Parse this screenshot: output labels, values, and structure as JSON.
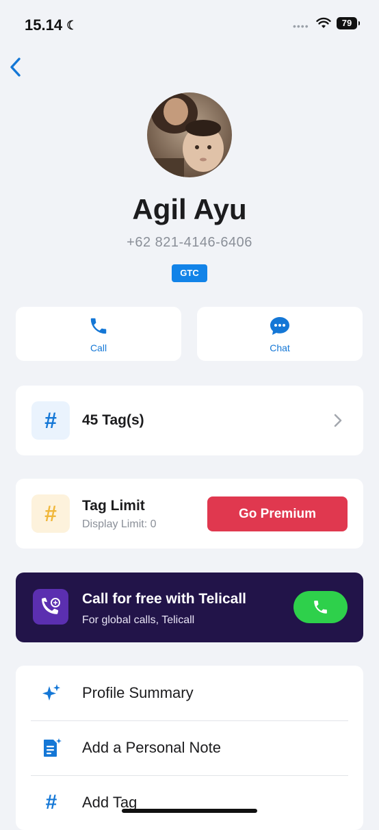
{
  "status_bar": {
    "time": "15.14",
    "moon_icon": "moon-icon",
    "battery": "79"
  },
  "contact": {
    "name": "Agil Ayu",
    "phone": "+62 821-4146-6406",
    "badge": "GTC"
  },
  "actions": [
    {
      "label": "Call",
      "icon": "phone-icon"
    },
    {
      "label": "Chat",
      "icon": "chat-bubble-icon"
    }
  ],
  "tags": {
    "count_label": "45 Tag(s)",
    "icon": "hash-icon"
  },
  "tag_limit": {
    "title": "Tag Limit",
    "subtitle": "Display Limit: 0",
    "button": "Go Premium"
  },
  "telicall": {
    "title": "Call for free with Telicall",
    "subtitle": "For global calls, Telicall"
  },
  "menu": [
    {
      "label": "Profile Summary",
      "icon": "sparkles-icon"
    },
    {
      "label": "Add a Personal Note",
      "icon": "note-icon"
    },
    {
      "label": "Add Tag",
      "icon": "hash-icon"
    }
  ],
  "colors": {
    "accent": "#1477d6",
    "premium": "#e0384f",
    "telicall_bg": "#221449",
    "call_green": "#2ed04b"
  }
}
